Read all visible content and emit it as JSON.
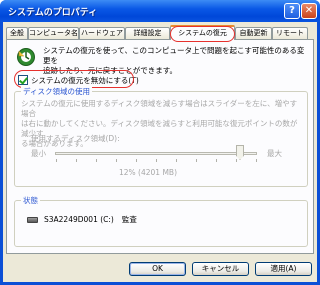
{
  "window": {
    "title": "システムのプロパティ",
    "help_label": "?",
    "close_label": "✕"
  },
  "tabs": [
    {
      "label": "全般"
    },
    {
      "label": "コンピュータ名"
    },
    {
      "label": "ハードウェア"
    },
    {
      "label": "詳細設定"
    },
    {
      "label": "システムの復元"
    },
    {
      "label": "自動更新"
    },
    {
      "label": "リモート"
    }
  ],
  "active_tab": "システムの復元",
  "intro_text": "システムの復元を使って、このコンピュータ上で問題を起こす可能性のある変更を\n追跡したり、元に戻すことができます。",
  "disable_checkbox": {
    "label": "システムの復元を無効にする(T)",
    "checked": true
  },
  "disk_space": {
    "group_title": "ディスク領域の使用",
    "description": "システムの復元に使用するディスク領域を減らす場合はスライダーを左に、増やす場合\nは右に動かしてください。ディスク領域を減らすと利用可能な復元ポイントの数が減少す\nる場合があります。",
    "usage_label": "使用するディスク領域(D):",
    "min_label": "最小",
    "max_label": "最大",
    "slider_value_text": "12% (4201 MB)",
    "slider_fraction": 0.9
  },
  "status": {
    "group_title": "状態",
    "drive_name": "S3A2249D001 (C:)",
    "drive_status": "監査"
  },
  "buttons": {
    "ok": "OK",
    "cancel": "キャンセル",
    "apply": "適用(A)"
  },
  "colors": {
    "accent_highlight": "#e6312d",
    "group_title": "#2b56d1",
    "titlebar": "#0047d9"
  }
}
